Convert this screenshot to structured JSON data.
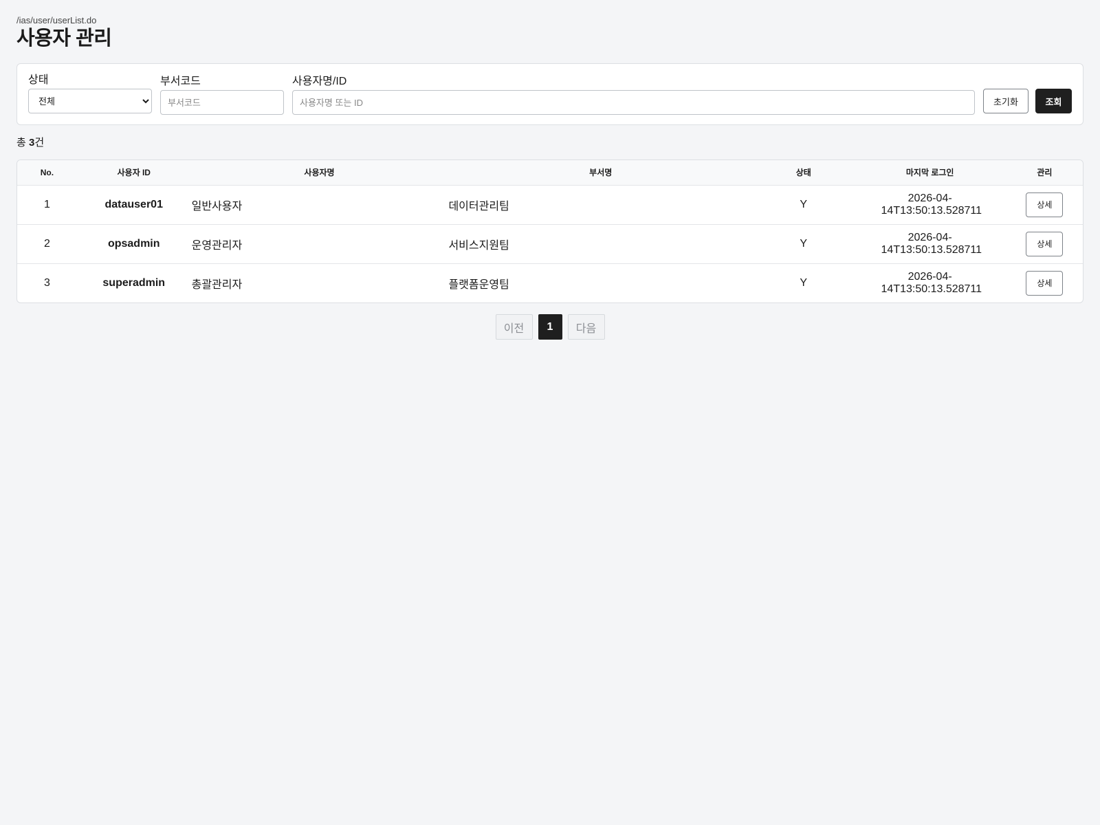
{
  "header": {
    "path": "/ias/user/userList.do",
    "title": "사용자 관리"
  },
  "search": {
    "status_label": "상태",
    "status_value": "전체",
    "dept_label": "부서코드",
    "dept_placeholder": "부서코드",
    "dept_value": "",
    "name_label": "사용자명/ID",
    "name_placeholder": "사용자명 또는 ID",
    "name_value": "",
    "reset_label": "초기화",
    "search_label": "조회"
  },
  "summary": {
    "prefix": "총",
    "count": "3",
    "suffix": "건"
  },
  "table": {
    "headers": [
      "No.",
      "사용자 ID",
      "사용자명",
      "부서명",
      "상태",
      "마지막 로그인",
      "관리"
    ],
    "rows": [
      {
        "no": "1",
        "user_id": "datauser01",
        "user_name": "일반사용자",
        "dept": "데이터관리팀",
        "status": "Y",
        "last_login": "2026-04-14T13:50:13.528711",
        "action": "상세"
      },
      {
        "no": "2",
        "user_id": "opsadmin",
        "user_name": "운영관리자",
        "dept": "서비스지원팀",
        "status": "Y",
        "last_login": "2026-04-14T13:50:13.528711",
        "action": "상세"
      },
      {
        "no": "3",
        "user_id": "superadmin",
        "user_name": "총괄관리자",
        "dept": "플랫폼운영팀",
        "status": "Y",
        "last_login": "2026-04-14T13:50:13.528711",
        "action": "상세"
      }
    ]
  },
  "pagination": {
    "prev_label": "이전",
    "current_page": "1",
    "next_label": "다음"
  }
}
